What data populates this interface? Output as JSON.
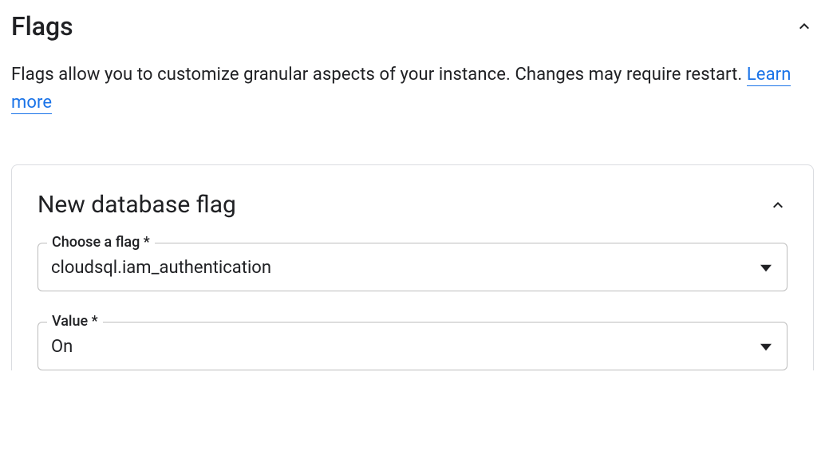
{
  "section": {
    "title": "Flags",
    "description_prefix": "Flags allow you to customize granular aspects of your instance. Changes may require restart. ",
    "learn_more_label": "Learn more"
  },
  "card": {
    "title": "New database flag",
    "flag_field": {
      "label": "Choose a flag *",
      "value": "cloudsql.iam_authentication"
    },
    "value_field": {
      "label": "Value *",
      "value": "On"
    }
  }
}
